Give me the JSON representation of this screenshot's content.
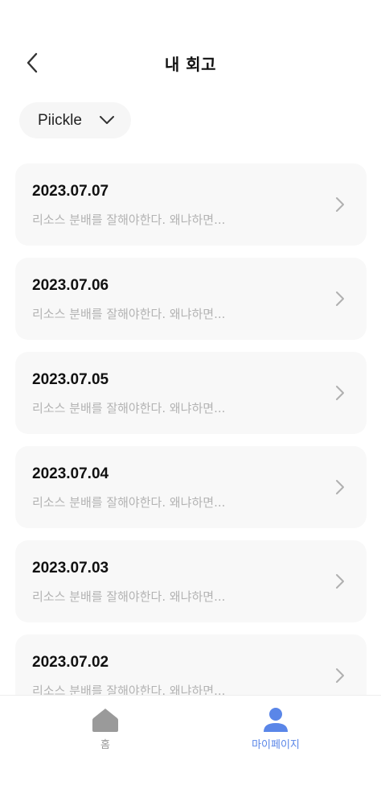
{
  "header": {
    "title": "내 회고",
    "back_icon": "chevron-left-icon"
  },
  "filter": {
    "selected": "Piickle",
    "icon": "chevron-down-icon"
  },
  "retrospects": [
    {
      "date": "2023.07.07",
      "preview": "리소스 분배를 잘해야한다. 왜냐하면..."
    },
    {
      "date": "2023.07.06",
      "preview": "리소스 분배를 잘해야한다. 왜냐하면..."
    },
    {
      "date": "2023.07.05",
      "preview": "리소스 분배를 잘해야한다. 왜냐하면..."
    },
    {
      "date": "2023.07.04",
      "preview": "리소스 분배를 잘해야한다. 왜냐하면..."
    },
    {
      "date": "2023.07.03",
      "preview": "리소스 분배를 잘해야한다. 왜냐하면..."
    },
    {
      "date": "2023.07.02",
      "preview": "리소스 분배를 잘해야한다. 왜냐하면..."
    }
  ],
  "bottom_nav": {
    "items": [
      {
        "label": "홈",
        "icon": "home-icon",
        "active": false
      },
      {
        "label": "마이페이지",
        "icon": "user-icon",
        "active": true
      }
    ],
    "active_color": "#5a86e8",
    "inactive_color": "#9a9a9a"
  }
}
